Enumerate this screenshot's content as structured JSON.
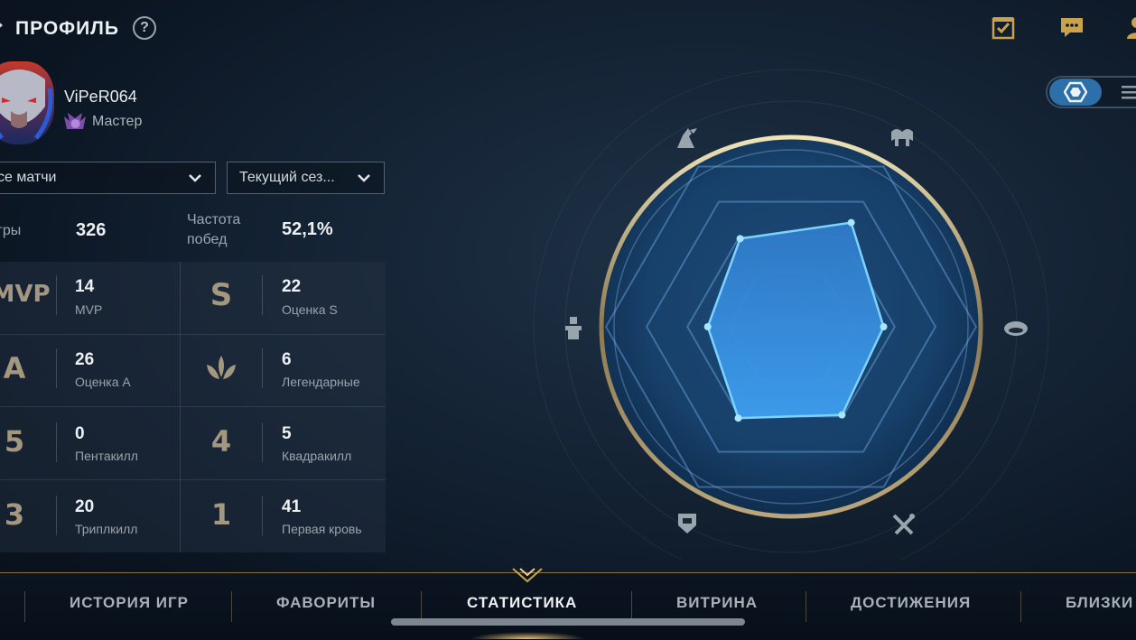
{
  "header": {
    "title": "ПРОФИЛЬ",
    "help": "?"
  },
  "toolbar": {
    "icons": [
      "clipboard-check-icon",
      "chat-icon",
      "user-icon"
    ]
  },
  "profile": {
    "username": "ViPeR064",
    "rank": "Мастер"
  },
  "filters": {
    "match_type": "се матчи",
    "season": "Текущий сез..."
  },
  "summary": {
    "games_label": "гры",
    "games_value": "326",
    "winrate_label_1": "Частота",
    "winrate_label_2": "побед",
    "winrate_value": "52,1%"
  },
  "stats": [
    {
      "icon": "MVP",
      "value": "14",
      "label": "MVP"
    },
    {
      "icon": "S",
      "value": "22",
      "label": "Оценка S"
    },
    {
      "icon": "A",
      "value": "26",
      "label": "Оценка A"
    },
    {
      "icon": "legendary-icon",
      "value": "6",
      "label": "Легендарные"
    },
    {
      "icon": "5",
      "value": "0",
      "label": "Пентакилл"
    },
    {
      "icon": "4",
      "value": "5",
      "label": "Квадракилл"
    },
    {
      "icon": "3",
      "value": "20",
      "label": "Триплкилл"
    },
    {
      "icon": "1",
      "value": "41",
      "label": "Первая кровь"
    }
  ],
  "radar": {
    "axes": [
      "assassin-icon",
      "fighter-icon",
      "marksman-icon",
      "tank-icon",
      "support-icon",
      "mage-icon"
    ],
    "values": [
      0.55,
      0.65,
      0.5,
      0.55,
      0.57,
      0.45
    ],
    "accent": "#3d9ae8"
  },
  "view_toggle": {
    "active": "radar-view-icon",
    "inactive": "list-view-icon"
  },
  "tabs": [
    {
      "label": "ИСТОРИЯ ИГР",
      "active": false
    },
    {
      "label": "ФАВОРИТЫ",
      "active": false
    },
    {
      "label": "СТАТИСТИКА",
      "active": true
    },
    {
      "label": "ВИТРИНА",
      "active": false
    },
    {
      "label": "ДОСТИЖЕНИЯ",
      "active": false
    },
    {
      "label": "БЛИЗКИ",
      "active": false
    }
  ]
}
